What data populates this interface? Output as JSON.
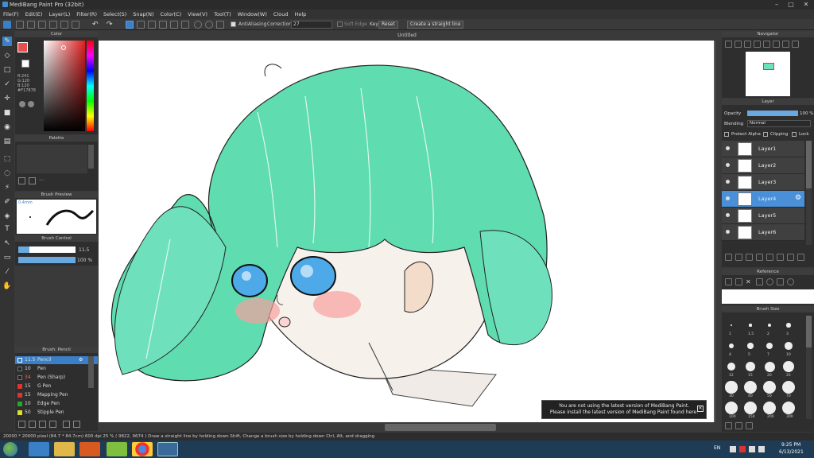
{
  "titlebar": {
    "title": "MediBang Paint Pro (32bit)"
  },
  "menu": [
    "File(F)",
    "Edit(E)",
    "Layer(L)",
    "Filter(R)",
    "Select(S)",
    "Snap(N)",
    "Color(C)",
    "View(V)",
    "Tool(T)",
    "Window(W)",
    "Cloud",
    "Help"
  ],
  "toolbar": {
    "antialiasing": "AntiAliasing",
    "correction_label": "Correction",
    "correction_value": "27",
    "soft_edge": "Soft Edge",
    "key": "Key",
    "reset": "Reset",
    "straight_line": "Create a straight line"
  },
  "color_panel": {
    "title": "Color",
    "r": "R:241",
    "g": "G:120",
    "b": "B:120",
    "hex": "#F17878",
    "fg_color": "#e85050"
  },
  "palette": {
    "title": "Palette"
  },
  "brush_preview": {
    "title": "Brush Preview",
    "size": "0.4mm"
  },
  "brush_control": {
    "title": "Brush Control",
    "size": "11.5",
    "opacity": "100 %"
  },
  "brush_list": {
    "title": "Brush: Pencil",
    "items": [
      {
        "size": "11.5",
        "name": "Pencil",
        "color": "#2a7bd0",
        "selected": true
      },
      {
        "size": "10",
        "name": "Pen",
        "color": "#222"
      },
      {
        "size": "34",
        "name": "Pen (Sharp)",
        "color": "#222"
      },
      {
        "size": "15",
        "name": "G Pen",
        "color": "#d33"
      },
      {
        "size": "15",
        "name": "Mapping Pen",
        "color": "#d33"
      },
      {
        "size": "10",
        "name": "Edge Pen",
        "color": "#2a2"
      },
      {
        "size": "50",
        "name": "Stipple Pen",
        "color": "#dd3"
      }
    ]
  },
  "document": {
    "tab": "Untitled"
  },
  "navigator": {
    "title": "Navigator"
  },
  "layer_panel": {
    "title": "Layer",
    "opacity_label": "Opacity",
    "opacity_value": "100 %",
    "blending_label": "Blending",
    "blending_value": "Normal",
    "protect_alpha": "Protect Alpha",
    "clipping": "Clipping",
    "lock": "Lock",
    "layers": [
      "Layer1",
      "Layer2",
      "Layer3",
      "Layer4",
      "Layer5",
      "Layer6"
    ],
    "selected_index": 3
  },
  "reference": {
    "title": "Reference"
  },
  "brush_size": {
    "title": "Brush Size",
    "labels": [
      "1",
      "1.5",
      "2",
      "3",
      "4",
      "5",
      "7",
      "10",
      "12",
      "15",
      "20",
      "25",
      "30",
      "40",
      "50",
      "70",
      "100",
      "150",
      "200",
      "300"
    ]
  },
  "notice": {
    "line1": "You are not using the latest version of MediBang Paint.",
    "line2": "Please install the latest version of MediBang Paint found here."
  },
  "statusbar": "20000 * 20000 pixel  (84.7 * 84.7cm)  600 dpi  25 %  ( 9822, 9674 )  Draw a straight line by holding down Shift, Change a brush size by holding down Ctrl, Alt, and dragging",
  "taskbar": {
    "lang": "EN",
    "time": "9:25 PM",
    "date": "6/13/2021"
  }
}
